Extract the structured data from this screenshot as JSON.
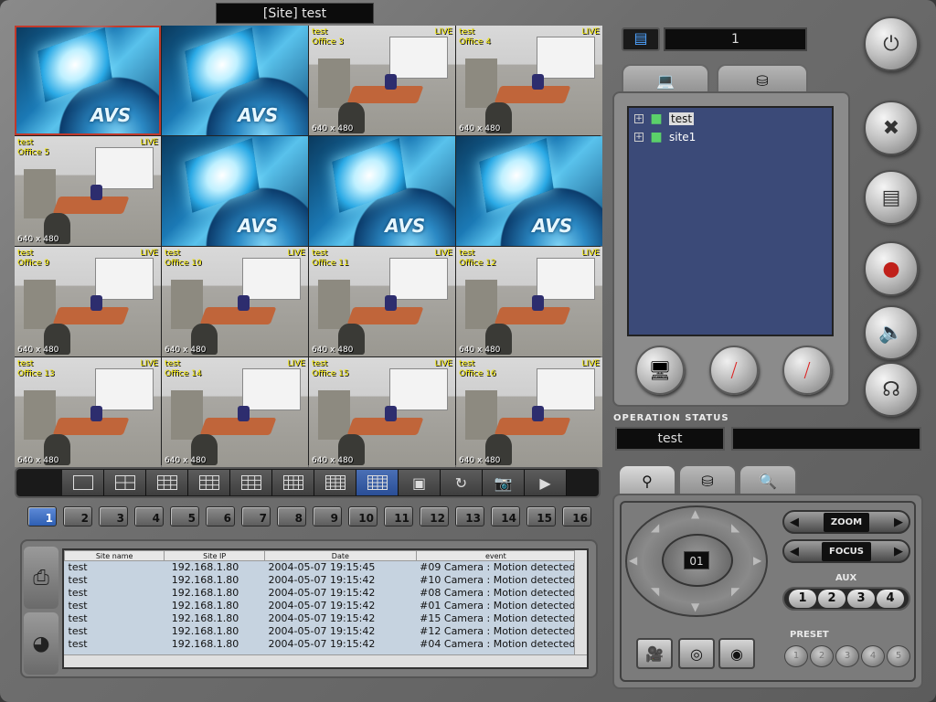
{
  "window": {
    "title": "[Site] test"
  },
  "cameras": [
    {
      "kind": "logo",
      "site": "",
      "name": "",
      "live": "",
      "res": "",
      "selected": true
    },
    {
      "kind": "logo",
      "site": "",
      "name": "",
      "live": "",
      "res": ""
    },
    {
      "kind": "office",
      "site": "test",
      "name": "Office 3",
      "live": "LIVE",
      "res": "640 x 480"
    },
    {
      "kind": "office",
      "site": "test",
      "name": "Office 4",
      "live": "LIVE",
      "res": "640 x 480"
    },
    {
      "kind": "office",
      "site": "test",
      "name": "Office 5",
      "live": "LIVE",
      "res": "640 x 480"
    },
    {
      "kind": "logo",
      "site": "",
      "name": "",
      "live": "",
      "res": ""
    },
    {
      "kind": "logo",
      "site": "",
      "name": "",
      "live": "",
      "res": ""
    },
    {
      "kind": "logo",
      "site": "",
      "name": "",
      "live": "",
      "res": ""
    },
    {
      "kind": "office",
      "site": "test",
      "name": "Office 9",
      "live": "LIVE",
      "res": "640 x 480"
    },
    {
      "kind": "office",
      "site": "test",
      "name": "Office 10",
      "live": "LIVE",
      "res": "640 x 480"
    },
    {
      "kind": "office",
      "site": "test",
      "name": "Office 11",
      "live": "LIVE",
      "res": "640 x 480"
    },
    {
      "kind": "office",
      "site": "test",
      "name": "Office 12",
      "live": "LIVE",
      "res": "640 x 480"
    },
    {
      "kind": "office",
      "site": "test",
      "name": "Office 13",
      "live": "LIVE",
      "res": "640 x 480"
    },
    {
      "kind": "office",
      "site": "test",
      "name": "Office 14",
      "live": "LIVE",
      "res": "640 x 480"
    },
    {
      "kind": "office",
      "site": "test",
      "name": "Office 15",
      "live": "LIVE",
      "res": "640 x 480"
    },
    {
      "kind": "office",
      "site": "test",
      "name": "Office 16",
      "live": "LIVE",
      "res": "640 x 480"
    }
  ],
  "logo_text": "AVS",
  "layout_buttons": [
    {
      "icon": "layout-1-icon"
    },
    {
      "icon": "layout-4-icon"
    },
    {
      "icon": "layout-6-icon"
    },
    {
      "icon": "layout-8-icon"
    },
    {
      "icon": "layout-9-icon"
    },
    {
      "icon": "layout-10-icon"
    },
    {
      "icon": "layout-13-icon"
    },
    {
      "icon": "layout-16-icon",
      "active": true
    },
    {
      "icon": "fullscreen-icon"
    },
    {
      "icon": "sequence-icon"
    },
    {
      "icon": "snapshot-icon"
    },
    {
      "icon": "play-icon"
    }
  ],
  "pages": [
    "1",
    "2",
    "3",
    "4",
    "5",
    "6",
    "7",
    "8",
    "9",
    "10",
    "11",
    "12",
    "13",
    "14",
    "15",
    "16"
  ],
  "active_page": "1",
  "log": {
    "columns": [
      "Site name",
      "Site IP",
      "Date",
      "event"
    ],
    "rows": [
      [
        "test",
        "192.168.1.80",
        "2004-05-07 19:15:45",
        "#09 Camera : Motion detected"
      ],
      [
        "test",
        "192.168.1.80",
        "2004-05-07 19:15:42",
        "#10 Camera : Motion detected"
      ],
      [
        "test",
        "192.168.1.80",
        "2004-05-07 19:15:42",
        "#08 Camera : Motion detected"
      ],
      [
        "test",
        "192.168.1.80",
        "2004-05-07 19:15:42",
        "#01 Camera : Motion detected"
      ],
      [
        "test",
        "192.168.1.80",
        "2004-05-07 19:15:42",
        "#15 Camera : Motion detected"
      ],
      [
        "test",
        "192.168.1.80",
        "2004-05-07 19:15:42",
        "#12 Camera : Motion detected"
      ],
      [
        "test",
        "192.168.1.80",
        "2004-05-07 19:15:42",
        "#04 Camera : Motion detected"
      ]
    ]
  },
  "channel": {
    "value": "1"
  },
  "tree": {
    "items": [
      {
        "label": "test",
        "selected": true
      },
      {
        "label": "site1"
      }
    ]
  },
  "operation_status": {
    "label": "OPERATION STATUS",
    "value": "test",
    "detail": ""
  },
  "ptz": {
    "preset_number": "01",
    "zoom_label": "ZOOM",
    "focus_label": "FOCUS",
    "aux_label": "AUX",
    "aux_buttons": [
      "1",
      "2",
      "3",
      "4"
    ],
    "preset_label": "PRESET",
    "preset_buttons": [
      "1",
      "2",
      "3",
      "4",
      "5"
    ]
  }
}
